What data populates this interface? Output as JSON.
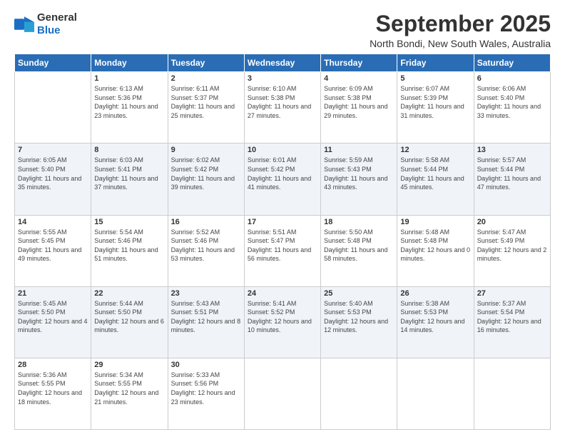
{
  "header": {
    "logo_general": "General",
    "logo_blue": "Blue",
    "month": "September 2025",
    "location": "North Bondi, New South Wales, Australia"
  },
  "weekdays": [
    "Sunday",
    "Monday",
    "Tuesday",
    "Wednesday",
    "Thursday",
    "Friday",
    "Saturday"
  ],
  "weeks": [
    [
      {
        "day": "",
        "sunrise": "",
        "sunset": "",
        "daylight": ""
      },
      {
        "day": "1",
        "sunrise": "Sunrise: 6:13 AM",
        "sunset": "Sunset: 5:36 PM",
        "daylight": "Daylight: 11 hours and 23 minutes."
      },
      {
        "day": "2",
        "sunrise": "Sunrise: 6:11 AM",
        "sunset": "Sunset: 5:37 PM",
        "daylight": "Daylight: 11 hours and 25 minutes."
      },
      {
        "day": "3",
        "sunrise": "Sunrise: 6:10 AM",
        "sunset": "Sunset: 5:38 PM",
        "daylight": "Daylight: 11 hours and 27 minutes."
      },
      {
        "day": "4",
        "sunrise": "Sunrise: 6:09 AM",
        "sunset": "Sunset: 5:38 PM",
        "daylight": "Daylight: 11 hours and 29 minutes."
      },
      {
        "day": "5",
        "sunrise": "Sunrise: 6:07 AM",
        "sunset": "Sunset: 5:39 PM",
        "daylight": "Daylight: 11 hours and 31 minutes."
      },
      {
        "day": "6",
        "sunrise": "Sunrise: 6:06 AM",
        "sunset": "Sunset: 5:40 PM",
        "daylight": "Daylight: 11 hours and 33 minutes."
      }
    ],
    [
      {
        "day": "7",
        "sunrise": "Sunrise: 6:05 AM",
        "sunset": "Sunset: 5:40 PM",
        "daylight": "Daylight: 11 hours and 35 minutes."
      },
      {
        "day": "8",
        "sunrise": "Sunrise: 6:03 AM",
        "sunset": "Sunset: 5:41 PM",
        "daylight": "Daylight: 11 hours and 37 minutes."
      },
      {
        "day": "9",
        "sunrise": "Sunrise: 6:02 AM",
        "sunset": "Sunset: 5:42 PM",
        "daylight": "Daylight: 11 hours and 39 minutes."
      },
      {
        "day": "10",
        "sunrise": "Sunrise: 6:01 AM",
        "sunset": "Sunset: 5:42 PM",
        "daylight": "Daylight: 11 hours and 41 minutes."
      },
      {
        "day": "11",
        "sunrise": "Sunrise: 5:59 AM",
        "sunset": "Sunset: 5:43 PM",
        "daylight": "Daylight: 11 hours and 43 minutes."
      },
      {
        "day": "12",
        "sunrise": "Sunrise: 5:58 AM",
        "sunset": "Sunset: 5:44 PM",
        "daylight": "Daylight: 11 hours and 45 minutes."
      },
      {
        "day": "13",
        "sunrise": "Sunrise: 5:57 AM",
        "sunset": "Sunset: 5:44 PM",
        "daylight": "Daylight: 11 hours and 47 minutes."
      }
    ],
    [
      {
        "day": "14",
        "sunrise": "Sunrise: 5:55 AM",
        "sunset": "Sunset: 5:45 PM",
        "daylight": "Daylight: 11 hours and 49 minutes."
      },
      {
        "day": "15",
        "sunrise": "Sunrise: 5:54 AM",
        "sunset": "Sunset: 5:46 PM",
        "daylight": "Daylight: 11 hours and 51 minutes."
      },
      {
        "day": "16",
        "sunrise": "Sunrise: 5:52 AM",
        "sunset": "Sunset: 5:46 PM",
        "daylight": "Daylight: 11 hours and 53 minutes."
      },
      {
        "day": "17",
        "sunrise": "Sunrise: 5:51 AM",
        "sunset": "Sunset: 5:47 PM",
        "daylight": "Daylight: 11 hours and 56 minutes."
      },
      {
        "day": "18",
        "sunrise": "Sunrise: 5:50 AM",
        "sunset": "Sunset: 5:48 PM",
        "daylight": "Daylight: 11 hours and 58 minutes."
      },
      {
        "day": "19",
        "sunrise": "Sunrise: 5:48 AM",
        "sunset": "Sunset: 5:48 PM",
        "daylight": "Daylight: 12 hours and 0 minutes."
      },
      {
        "day": "20",
        "sunrise": "Sunrise: 5:47 AM",
        "sunset": "Sunset: 5:49 PM",
        "daylight": "Daylight: 12 hours and 2 minutes."
      }
    ],
    [
      {
        "day": "21",
        "sunrise": "Sunrise: 5:45 AM",
        "sunset": "Sunset: 5:50 PM",
        "daylight": "Daylight: 12 hours and 4 minutes."
      },
      {
        "day": "22",
        "sunrise": "Sunrise: 5:44 AM",
        "sunset": "Sunset: 5:50 PM",
        "daylight": "Daylight: 12 hours and 6 minutes."
      },
      {
        "day": "23",
        "sunrise": "Sunrise: 5:43 AM",
        "sunset": "Sunset: 5:51 PM",
        "daylight": "Daylight: 12 hours and 8 minutes."
      },
      {
        "day": "24",
        "sunrise": "Sunrise: 5:41 AM",
        "sunset": "Sunset: 5:52 PM",
        "daylight": "Daylight: 12 hours and 10 minutes."
      },
      {
        "day": "25",
        "sunrise": "Sunrise: 5:40 AM",
        "sunset": "Sunset: 5:53 PM",
        "daylight": "Daylight: 12 hours and 12 minutes."
      },
      {
        "day": "26",
        "sunrise": "Sunrise: 5:38 AM",
        "sunset": "Sunset: 5:53 PM",
        "daylight": "Daylight: 12 hours and 14 minutes."
      },
      {
        "day": "27",
        "sunrise": "Sunrise: 5:37 AM",
        "sunset": "Sunset: 5:54 PM",
        "daylight": "Daylight: 12 hours and 16 minutes."
      }
    ],
    [
      {
        "day": "28",
        "sunrise": "Sunrise: 5:36 AM",
        "sunset": "Sunset: 5:55 PM",
        "daylight": "Daylight: 12 hours and 18 minutes."
      },
      {
        "day": "29",
        "sunrise": "Sunrise: 5:34 AM",
        "sunset": "Sunset: 5:55 PM",
        "daylight": "Daylight: 12 hours and 21 minutes."
      },
      {
        "day": "30",
        "sunrise": "Sunrise: 5:33 AM",
        "sunset": "Sunset: 5:56 PM",
        "daylight": "Daylight: 12 hours and 23 minutes."
      },
      {
        "day": "",
        "sunrise": "",
        "sunset": "",
        "daylight": ""
      },
      {
        "day": "",
        "sunrise": "",
        "sunset": "",
        "daylight": ""
      },
      {
        "day": "",
        "sunrise": "",
        "sunset": "",
        "daylight": ""
      },
      {
        "day": "",
        "sunrise": "",
        "sunset": "",
        "daylight": ""
      }
    ]
  ]
}
